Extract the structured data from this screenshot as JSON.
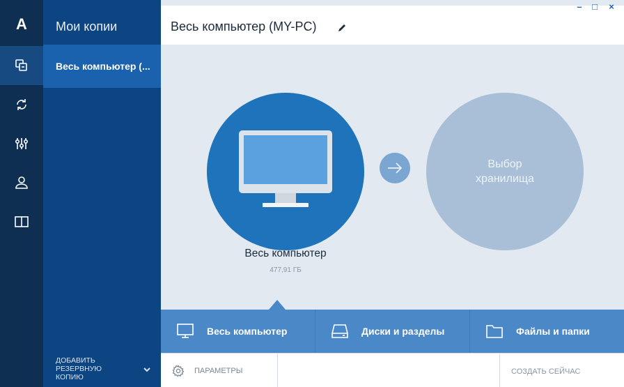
{
  "rail": {
    "logo": "A",
    "items": [
      {
        "icon": "backup-icon",
        "active": true
      },
      {
        "icon": "sync-icon",
        "active": false
      },
      {
        "icon": "tools-icon",
        "active": false
      },
      {
        "icon": "account-icon",
        "active": false
      },
      {
        "icon": "book-icon",
        "active": false
      }
    ]
  },
  "panel": {
    "title": "Мои копии",
    "selected_item": "Весь компьютер (...",
    "add_backup_label": "ДОБАВИТЬ РЕЗЕРВНУЮ КОПИЮ"
  },
  "main": {
    "title": "Весь компьютер (MY-PC)",
    "window_controls": {
      "minimize": "–",
      "maximize": "□",
      "close": "×"
    },
    "source": {
      "label": "Весь компьютер",
      "size": "477,91 ГБ"
    },
    "destination": {
      "label": "Выбор хранилища"
    },
    "tabs": [
      {
        "label": "Весь компьютер",
        "icon": "monitor-icon"
      },
      {
        "label": "Диски и разделы",
        "icon": "disk-icon"
      },
      {
        "label": "Файлы и папки",
        "icon": "folder-icon"
      }
    ],
    "bottom": {
      "params_label": "ПАРАМЕТРЫ",
      "create_now_label": "СОЗДАТЬ СЕЙЧАС"
    }
  },
  "colors": {
    "rail_bg": "#0e2f52",
    "panel_bg": "#0d4482",
    "accent": "#1e73bb",
    "tab_bg": "#4a88c7",
    "destination": "#a9bfd8"
  }
}
